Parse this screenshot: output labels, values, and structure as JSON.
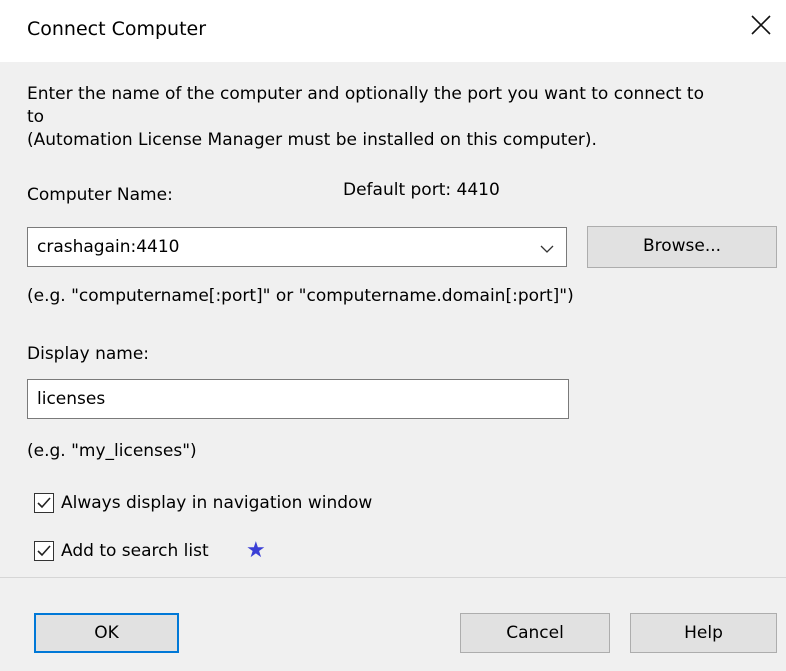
{
  "window": {
    "title": "Connect Computer",
    "close_icon": "close-icon"
  },
  "description": "Enter the name of the computer and optionally the port you want to connect to (Automation License Manager must be installed on this computer).",
  "description_lines": [
    "Enter the name of the computer and optionally the port you want to connect to",
    "to",
    "(Automation License Manager must be installed on this computer)."
  ],
  "computer_name": {
    "label": "Computer Name:",
    "default_port": "Default port: 4410",
    "value": "crashagain:4410",
    "dropdown_icon": "chevron-down-icon",
    "browse_label": "Browse...",
    "hint": "(e.g. \"computername[:port]\" or \"computername.domain[:port]\")"
  },
  "display_name": {
    "label": "Display name:",
    "value": "licenses",
    "hint": "(e.g. \"my_licenses\")"
  },
  "options": [
    {
      "label": "Always display in navigation window",
      "checked": true
    },
    {
      "label": "Add to search list",
      "checked": true
    }
  ],
  "star_icon": "star-icon",
  "buttons": {
    "ok": "OK",
    "cancel": "Cancel",
    "help": "Help"
  },
  "colors": {
    "dialog_bg": "#f0f0f0",
    "title_bg": "#ffffff",
    "default_button_border": "#0078d7",
    "star": "#3a3fd6"
  }
}
